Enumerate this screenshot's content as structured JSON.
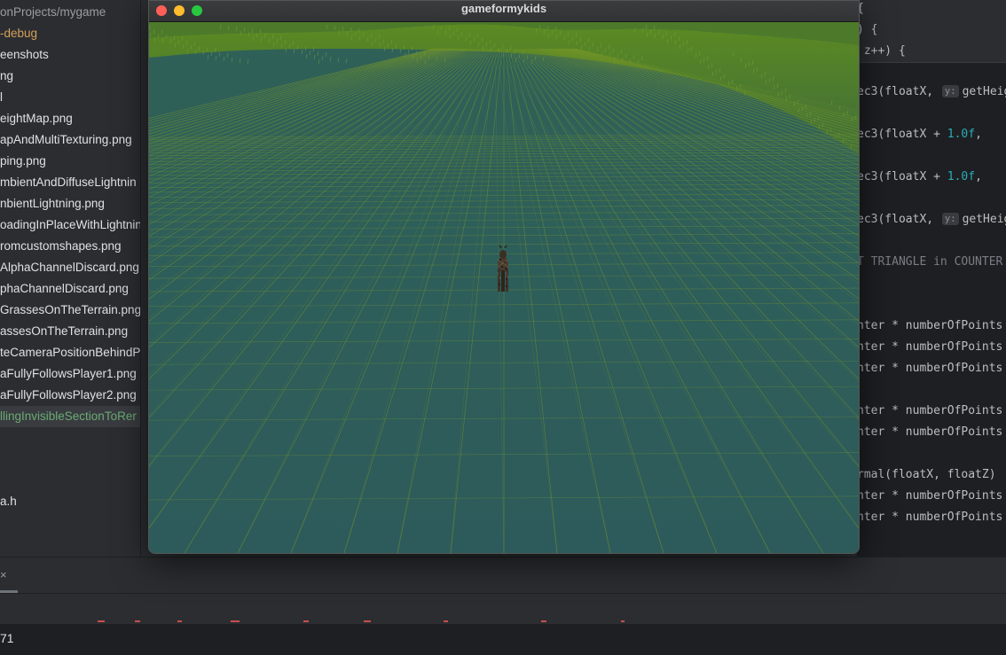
{
  "sidebar": {
    "items": [
      {
        "label": "onProjects/mygame",
        "style": "muted"
      },
      {
        "label": "-debug",
        "style": "orange"
      },
      {
        "label": "eenshots",
        "style": ""
      },
      {
        "label": "ng",
        "style": ""
      },
      {
        "label": "l",
        "style": ""
      },
      {
        "label": "eightMap.png",
        "style": ""
      },
      {
        "label": "apAndMultiTexturing.png",
        "style": ""
      },
      {
        "label": "ping.png",
        "style": ""
      },
      {
        "label": "mbientAndDiffuseLightnin",
        "style": ""
      },
      {
        "label": "nbientLightning.png",
        "style": ""
      },
      {
        "label": "oadingInPlaceWithLightnin",
        "style": ""
      },
      {
        "label": "romcustomshapes.png",
        "style": ""
      },
      {
        "label": "AlphaChannelDiscard.png",
        "style": ""
      },
      {
        "label": "phaChannelDiscard.png",
        "style": ""
      },
      {
        "label": "GrassesOnTheTerrain.png",
        "style": ""
      },
      {
        "label": "assesOnTheTerrain.png",
        "style": ""
      },
      {
        "label": "teCameraPositionBehindP",
        "style": ""
      },
      {
        "label": "aFullyFollowsPlayer1.png",
        "style": ""
      },
      {
        "label": "aFullyFollowsPlayer2.png",
        "style": ""
      },
      {
        "label": "llingInvisibleSectionToRer",
        "style": "green selected"
      },
      {
        "label": "a.h",
        "style": ""
      }
    ]
  },
  "editor": {
    "sticky": [
      "{",
      ") {",
      " z++) {"
    ],
    "lines": [
      {
        "pre": "ec3(floatX, ",
        "hint": "y:",
        "post": "getHeig",
        "num": "",
        "tail": ""
      },
      {
        "pre": "ec3(floatX + ",
        "hint": "",
        "post": "",
        "num": "1.0f",
        "tail": ", "
      },
      {
        "pre": "ec3(floatX + ",
        "hint": "",
        "post": "",
        "num": "1.0f",
        "tail": ", "
      },
      {
        "pre": "ec3(floatX, ",
        "hint": "y:",
        "post": "getHeig",
        "num": "",
        "tail": ""
      },
      {
        "comment": "T TRIANGLE in COUNTER"
      },
      {
        "text": "nter * numberOfPoints"
      },
      {
        "text": "nter * numberOfPoints"
      },
      {
        "text": "nter * numberOfPoints"
      },
      {
        "text": "nter * numberOfPoints"
      },
      {
        "text": "nter * numberOfPoints"
      },
      {
        "text": "rmal(floatX, floatZ)"
      },
      {
        "text": "nter * numberOfPoints"
      },
      {
        "text": "nter * numberOfPoints"
      }
    ]
  },
  "game_window": {
    "title": "gameformykids"
  },
  "bottom": {
    "close_glyph": "×",
    "console_text": "71"
  },
  "colors": {
    "ground": "#2e5c5a",
    "grid_line": "#7a9a2a",
    "hills": "#5a8a1e",
    "close": "#fe5f57",
    "minimize": "#febc2e",
    "maximize": "#28c840"
  }
}
